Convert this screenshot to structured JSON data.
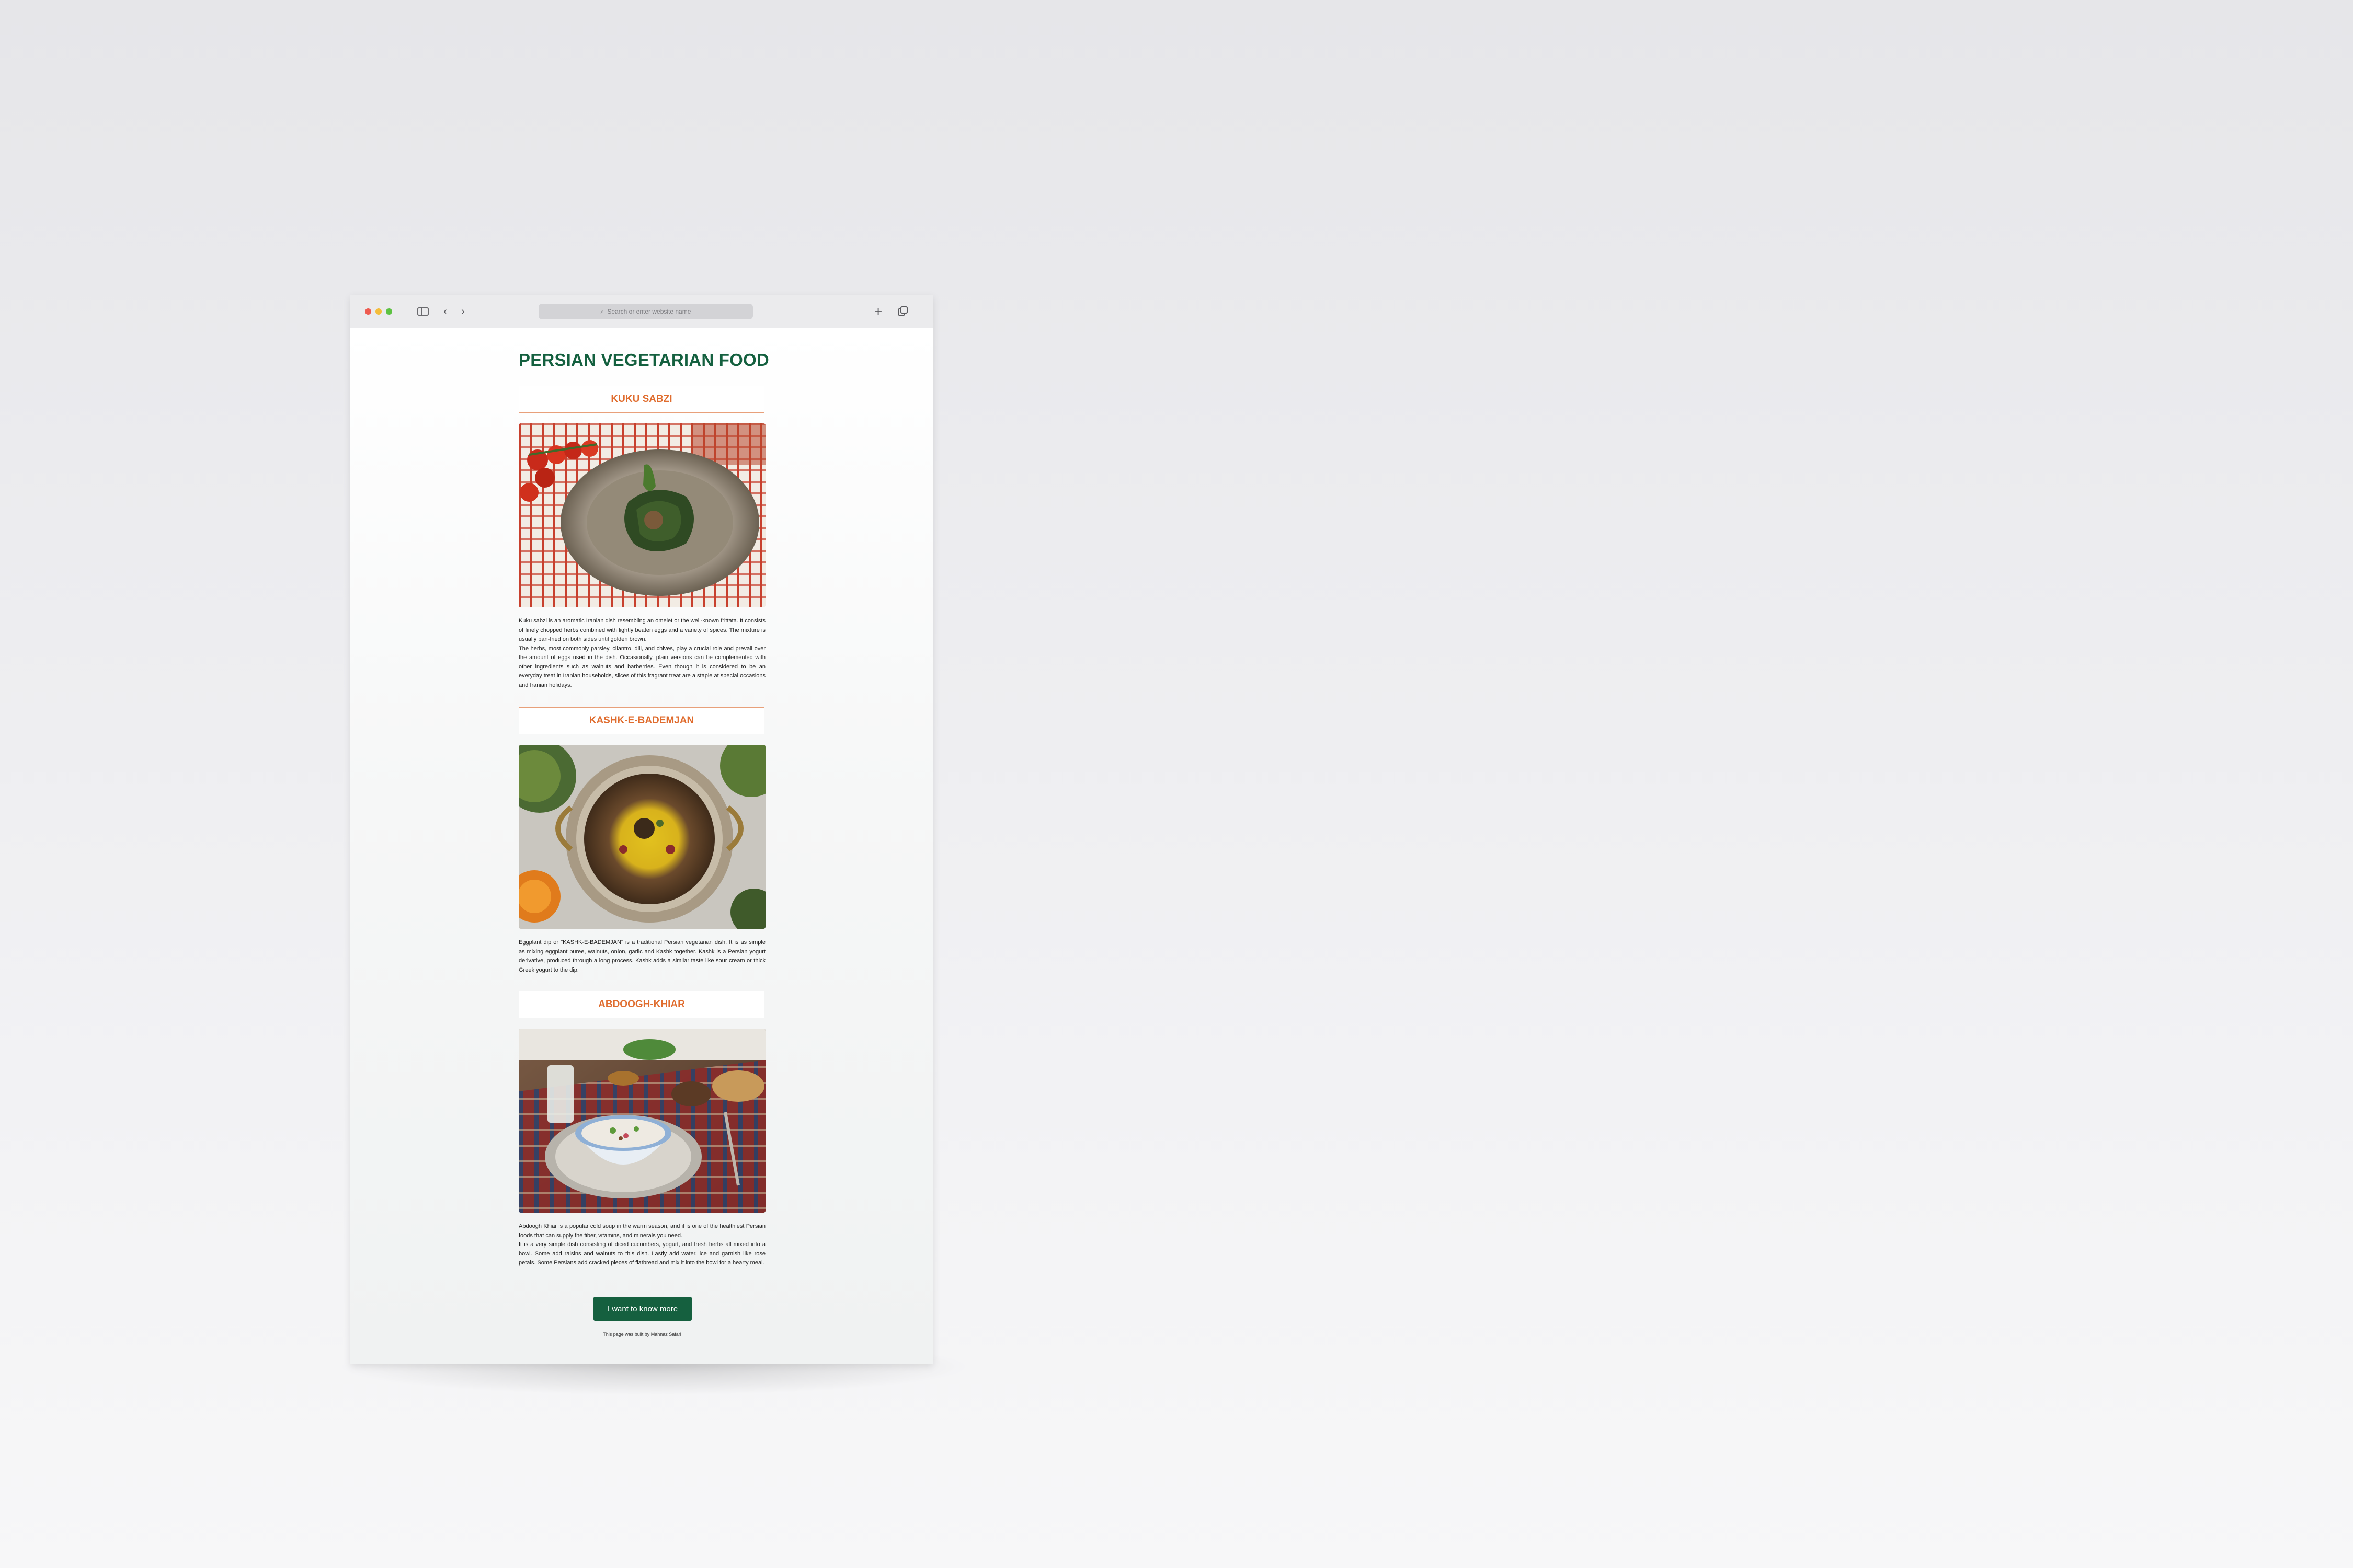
{
  "browser": {
    "address_placeholder": "Search or enter website name",
    "icons": [
      "sidebar-icon",
      "back-icon",
      "forward-icon",
      "search-icon",
      "new-tab-icon",
      "tabs-overview-icon"
    ]
  },
  "page": {
    "title": "PERSIAN VEGETARIAN FOOD",
    "dishes": [
      {
        "name": "KUKU SABZI",
        "paragraphs": [
          "Kuku sabzi is an aromatic Iranian dish resembling an omelet or the well-known frittata. It consists of finely chopped herbs combined with lightly beaten eggs and a variety of spices. The mixture is usually pan-fried on both sides until golden brown.",
          "The herbs, most commonly parsley, cilantro, dill, and chives, play a crucial role and prevail over the amount of eggs used in the dish. Occasionally, plain versions can be complemented with other ingredients such as walnuts and barberries. Even though it is considered to be an everyday treat in Iranian households, slices of this fragrant treat are a staple at special occasions and Iranian holidays."
        ]
      },
      {
        "name": "KASHK-E-BADEMJAN",
        "paragraphs": [
          "Eggplant dip or \"KASHK-E-BADEMJAN\" is a traditional Persian vegetarian dish. It is as simple as mixing eggplant puree, walnuts, onion, garlic and Kashk together. Kashk is a Persian yogurt derivative, produced through a long process. Kashk adds a similar taste like sour cream or thick Greek yogurt to the dip."
        ]
      },
      {
        "name": "ABDOOGH-KHIAR",
        "paragraphs": [
          "Abdoogh Khiar is a popular cold soup in the warm season, and it is one of the healthiest Persian foods that can supply the fiber, vitamins, and minerals you need.",
          "It is a very simple dish consisting of diced cucumbers, yogurt, and fresh herbs all mixed into a bowl. Some add raisins and walnuts to this dish. Lastly add water, ice and garnish like rose petals. Some Persians add cracked pieces of flatbread and mix it into the bowl for a hearty meal."
        ]
      }
    ],
    "cta_label": "I want to know more",
    "footer": "This page was built by Mahnaz Safari"
  },
  "colors": {
    "title_green": "#14603f",
    "heading_orange": "#e06d2f",
    "heading_border": "#e8a07a",
    "button_green": "#15603f"
  }
}
